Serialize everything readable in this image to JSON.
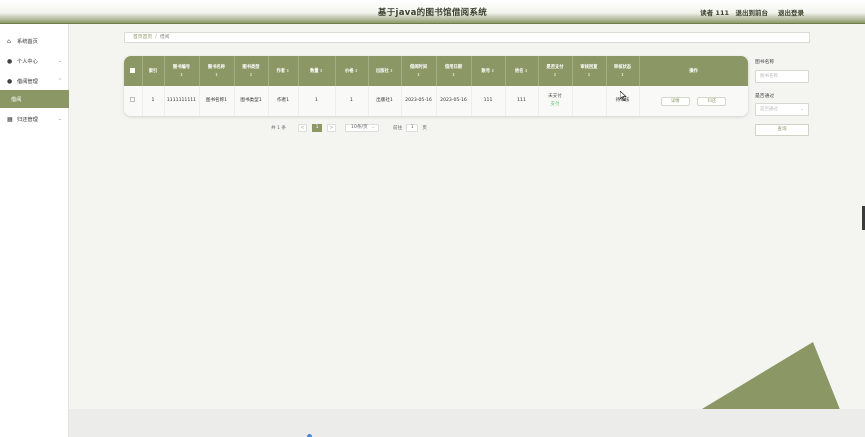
{
  "header": {
    "title": "基于java的图书馆借阅系统",
    "user_label": "读者 111",
    "back_label": "退出到前台",
    "logout_label": "退出登录"
  },
  "sidebar": {
    "items": [
      {
        "label": "系统首页",
        "icon": "home-icon"
      },
      {
        "label": "个人中心",
        "icon": "user-icon"
      },
      {
        "label": "借阅管理",
        "icon": "user-icon"
      },
      {
        "label": "借阅"
      },
      {
        "label": "归还管理",
        "icon": "grid-icon"
      }
    ]
  },
  "breadcrumb": {
    "home": "首页首页",
    "current": "借阅"
  },
  "table": {
    "columns": [
      "索引",
      "图书编号",
      "图书名称",
      "图书类型",
      "作者",
      "数量",
      "价格",
      "出版社",
      "借阅时间",
      "借用日期",
      "账号",
      "姓名",
      "是否支付",
      "审核回复",
      "审核状态",
      "操作"
    ],
    "rows": [
      {
        "index": "1",
        "book_no": "1111111111",
        "book_name": "图书名称1",
        "book_type": "图书类型1",
        "author": "作者1",
        "quantity": "1",
        "price": "1",
        "publisher": "出版社1",
        "borrow_time": "2023-05-16",
        "borrow_date": "2023-05-16",
        "account": "111",
        "name": "111",
        "pay_status": "未支付",
        "pay_link": "支付",
        "review_reply": "",
        "review_status": "待审核",
        "detail_btn": "详情",
        "return_btn": "归还"
      }
    ]
  },
  "pagination": {
    "total": "共 1 条",
    "prev": "<",
    "page": "1",
    "next": ">",
    "page_size": "10条/页",
    "goto_label": "前往",
    "goto_value": "1",
    "page_suffix": "页"
  },
  "search": {
    "name_label": "图书名称",
    "name_placeholder": "图书名称",
    "review_label": "是否通过",
    "review_placeholder": "是否通过",
    "query_btn": "查询"
  },
  "colors": {
    "accent": "#8b9866",
    "accent_dark": "#6f7d4c",
    "pay_link": "#6fbf7a"
  }
}
